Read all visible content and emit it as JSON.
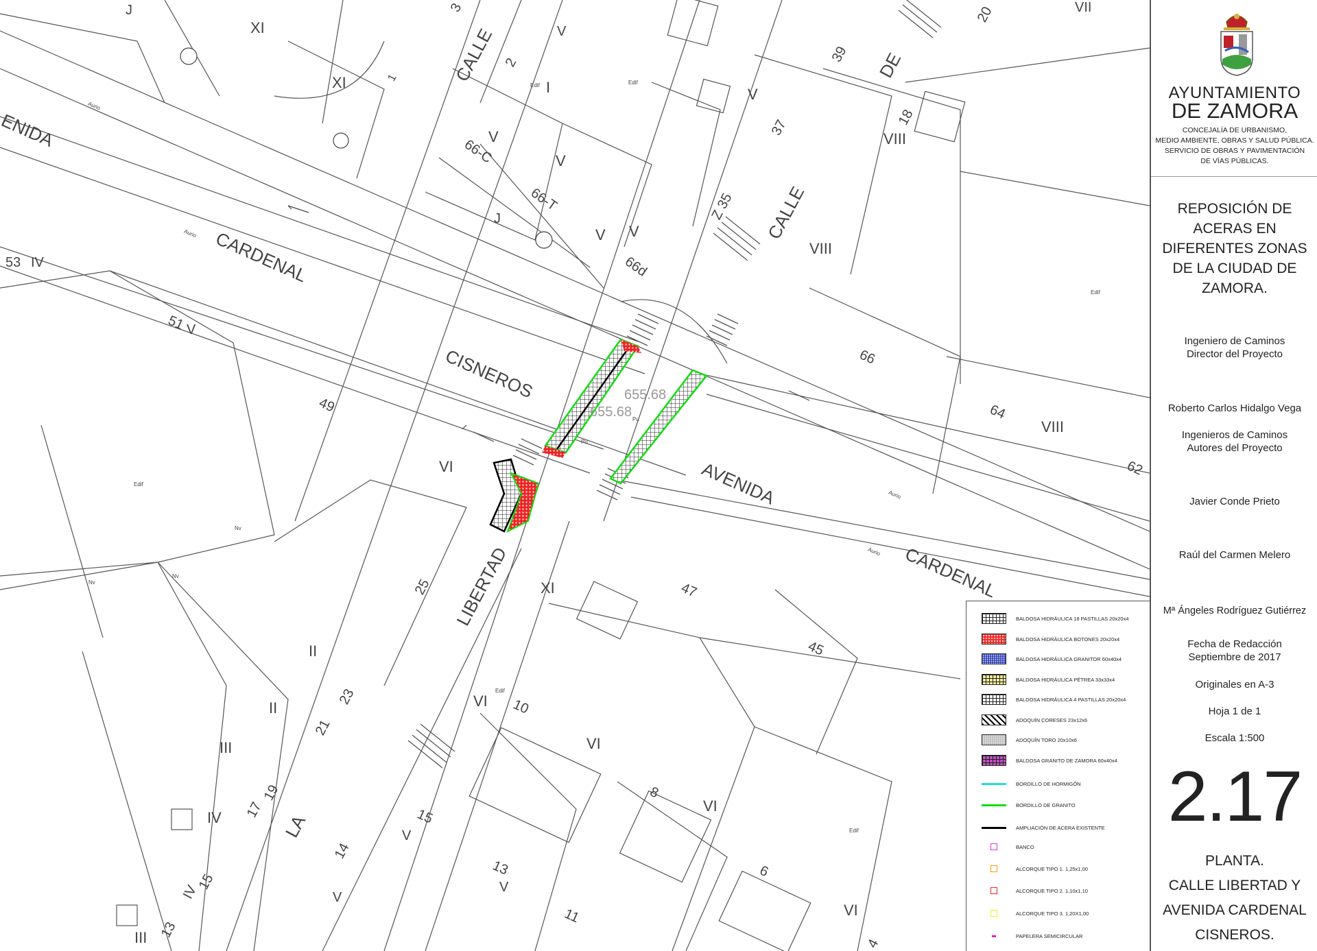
{
  "header": {
    "org_line1": "AYUNTAMIENTO",
    "org_line2": "DE ZAMORA",
    "department": [
      "CONCEJALÍA DE URBANISMO,",
      "MEDIO AMBIENTE, OBRAS Y SALUD PÚBLICA.",
      "SERVICIO DE OBRAS Y PAVIMENTACIÓN",
      "DE VÍAS PÚBLICAS."
    ]
  },
  "project": {
    "title": [
      "REPOSICIÓN DE",
      "ACERAS EN",
      "DIFERENTES ZONAS",
      "DE LA CIUDAD DE",
      "ZAMORA."
    ],
    "director_role": [
      "Ingeniero de Caminos",
      "Director del Proyecto"
    ],
    "director_name": "Roberto Carlos Hidalgo Vega",
    "authors_role": [
      "Ingenieros de Caminos",
      "Autores del Proyecto"
    ],
    "author1": "Javier Conde Prieto",
    "author2": "Raúl del Carmen Melero",
    "author3": "Mª Ángeles Rodríguez Gutiérrez",
    "date_label": "Fecha de Redacción",
    "date_value": "Septiembre de 2017",
    "originals": "Originales en A-3",
    "sheet": "Hoja 1 de 1",
    "scale": "Escala 1:500",
    "plan_number": "2.17",
    "plan_title": [
      "PLANTA.",
      "CALLE LIBERTAD Y",
      "AVENIDA CARDENAL",
      "CISNEROS."
    ]
  },
  "legend": [
    {
      "label": "BALDOSA HIDRÁULICA 18 PASTILLAS 20x20x4",
      "kind": "swatch",
      "color": "#888888",
      "pattern": "grid"
    },
    {
      "label": "BALDOSA HIDRÁULICA BOTONES 20x20x4",
      "kind": "swatch",
      "color": "#ee2222",
      "pattern": "dots"
    },
    {
      "label": "BALDOSA HIDRÁULICA GRANITOR 60x40x4",
      "kind": "swatch",
      "color": "#3344bb",
      "pattern": "fine"
    },
    {
      "label": "BALDOSA HIDRÁULICA PÉTREA 33x33x4",
      "kind": "swatch",
      "color": "#f2ec9a",
      "pattern": "grid"
    },
    {
      "label": "BALDOSA HIDRÁULICA 4 PASTILLAS 20x20x4",
      "kind": "swatch",
      "color": "#aaaaaa",
      "pattern": "grid"
    },
    {
      "label": "ADOQUÍN CORESES 23x12x6",
      "kind": "swatch",
      "color": "#222222",
      "pattern": "hatch"
    },
    {
      "label": "ADOQUÍN TORO 20x10x6",
      "kind": "swatch",
      "color": "#bbbbbb",
      "pattern": "fine"
    },
    {
      "label": "BALDOSA GRANITO DE ZAMORA 60x40x4",
      "kind": "swatch",
      "color": "#c050c0",
      "pattern": "grid"
    },
    {
      "label": "BORDILLO DE HORMIGÓN",
      "kind": "line",
      "color": "#22dddd"
    },
    {
      "label": "BORDILLO DE GRANITO",
      "kind": "line",
      "color": "#11dd11"
    },
    {
      "label": "AMPLIACIÓN DE ACERA EXISTENTE",
      "kind": "line",
      "color": "#000000"
    },
    {
      "label": "BANCO",
      "kind": "small",
      "color": "#dd33dd"
    },
    {
      "label": "ALCORQUE TIPO 1. 1,25x1,00",
      "kind": "small",
      "color": "#ff9900"
    },
    {
      "label": "ALCORQUE TIPO 2. 1,10x1,10",
      "kind": "small",
      "color": "#ee2222"
    },
    {
      "label": "ALCORQUE TIPO 3. 1,20X1,00",
      "kind": "small",
      "color": "#eeee22"
    },
    {
      "label": "PAPELERA SEMICIRCULAR",
      "kind": "dot",
      "color": "#ee22aa"
    }
  ],
  "map_labels": {
    "streets": [
      "CARDENAL",
      "CISNEROS",
      "AVENIDA",
      "CARDENAL",
      "LIBERTAD",
      "LA",
      "CALLE",
      "CALLE",
      "DE",
      "ENIDA"
    ],
    "numbers": [
      "53",
      "51",
      "49",
      "25",
      "23",
      "21",
      "17",
      "19",
      "15",
      "13",
      "14",
      "15",
      "13",
      "11",
      "10",
      "8",
      "6",
      "47",
      "45",
      "64",
      "62",
      "66",
      "66-C",
      "66-T",
      "66d",
      "Z 35",
      "37",
      "39",
      "20",
      "18",
      "2",
      "1",
      "3",
      "4"
    ],
    "romans": [
      "IV",
      "V",
      "VI",
      "XI",
      "XI",
      "J",
      "J",
      "V",
      "V",
      "V",
      "V",
      "V",
      "V",
      "I",
      "VIII",
      "VIII",
      "VIII",
      "II",
      "II",
      "III",
      "IV",
      "IV",
      "III",
      "VI",
      "VI",
      "VI",
      "VI",
      "V",
      "V",
      "V",
      "XI",
      "VII"
    ],
    "small": [
      "Edif",
      "Edif",
      "Edif",
      "Edif",
      "Edif",
      "Edif",
      "Nv",
      "Nv",
      "Nv",
      "Pu",
      "Pu",
      "Aurio",
      "Aurio",
      "Aurio",
      "Aurio"
    ],
    "elevation": "655.68",
    "elevation2": "655.68"
  },
  "colors": {
    "pavement_grid": "#888888",
    "buttons_red": "#ee2222",
    "granite_curb": "#11dd11",
    "linework": "#555555"
  }
}
